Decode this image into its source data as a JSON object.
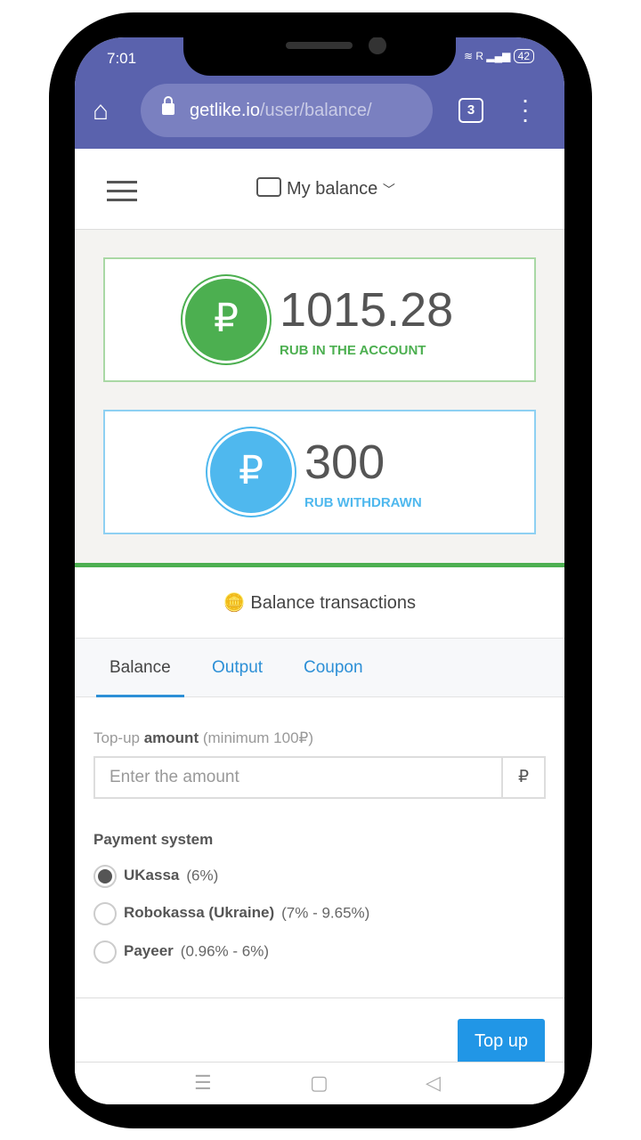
{
  "status": {
    "time": "7:01",
    "network": "R",
    "battery": "42"
  },
  "browser": {
    "domain": "getlike.io",
    "path": "/user/balance/",
    "tab_count": "3"
  },
  "nav": {
    "title": "My balance"
  },
  "cards": [
    {
      "amount": "1015.28",
      "label": "RUB IN THE ACCOUNT",
      "color": "#4caf50",
      "symbol": "₽"
    },
    {
      "amount": "300",
      "label": "RUB WITHDRAWN",
      "color": "#4fb8ee",
      "symbol": "₽"
    }
  ],
  "transactions": {
    "title": "Balance transactions",
    "tabs": [
      "Balance",
      "Output",
      "Coupon"
    ],
    "active_tab": "Balance"
  },
  "form": {
    "hint_prefix": "Top-up",
    "hint_bold": "amount",
    "hint_suffix": "(minimum 100₽)",
    "placeholder": "Enter the amount",
    "currency": "₽",
    "payment_label": "Payment system",
    "options": [
      {
        "name": "UKassa",
        "fee": "(6%)",
        "selected": true
      },
      {
        "name": "Robokassa (Ukraine)",
        "fee": "(7% - 9.65%)",
        "selected": false
      },
      {
        "name": "Payeer",
        "fee": "(0.96% - 6%)",
        "selected": false
      }
    ],
    "submit": "Top up"
  }
}
